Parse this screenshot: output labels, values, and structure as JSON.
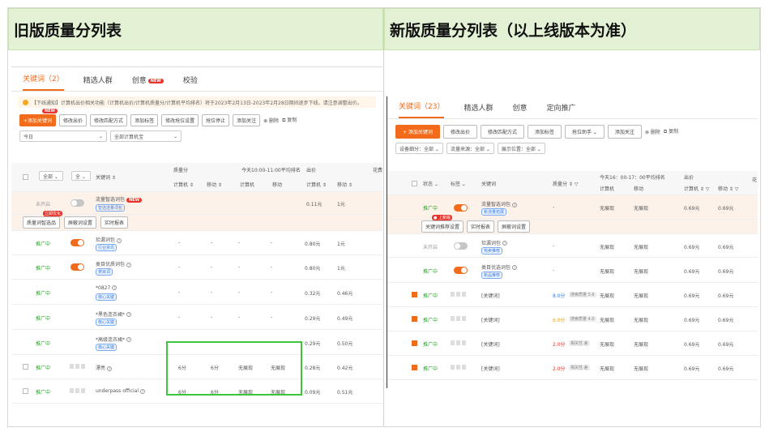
{
  "headers": {
    "left": "旧版质量分列表",
    "right": "新版质量分列表（以上线版本为准）"
  },
  "old": {
    "tabs": [
      {
        "label": "关键词（2）",
        "active": true
      },
      {
        "label": "精选人群"
      },
      {
        "label": "创意",
        "badge": "NEW"
      },
      {
        "label": "校验"
      }
    ],
    "notice": "【下线通知】计算机出价相关功能（计算机出价/计算机质量分/计算机平均排名）将于2023年2月13日-2023年2月28日期间逐步下线，请注意调整出价。",
    "toolbar": {
      "add": "+添加关键词",
      "add_badge": "NEW",
      "buttons": [
        "修改出价",
        "修改匹配方式",
        "添加标签",
        "修改抢位设置",
        "抢位停止",
        "添加关注"
      ],
      "delete": "删除",
      "copy": "复制"
    },
    "filters": {
      "date": "今日",
      "scope": "全部计算机宝"
    },
    "table_header": {
      "status_sel": "全部",
      "select2": "全",
      "keyword": "关键词",
      "qscore": "质量分",
      "rank_group": "今天10:00-11:00平均排名",
      "bid": "出价",
      "pc_qs": "计算机",
      "mobile_qs": "移动",
      "pc_rank": "计算机",
      "mobile_rank": "移动",
      "pc_bid": "计算机",
      "mobile_bid": "移动",
      "flow": "花费"
    },
    "pkg_row": {
      "status": "未开启",
      "name": "流量智选词包",
      "badge": "NEW",
      "tag": "智选选量词包",
      "bid_pc": "0.11元",
      "bid_mobile": "1元"
    },
    "pkg_actions": [
      "质量词智选品",
      "屏蔽词设置",
      "实时报表"
    ],
    "pkg_action_badge": "立即优化",
    "rows": [
      {
        "status": "推广中",
        "name": "捡漏词包",
        "tag": "行业资讯",
        "qs_pc": "-",
        "qs_mb": "-",
        "rk_pc": "-",
        "rk_mb": "-",
        "bid_pc": "0.80元",
        "bid_mb": "1元"
      },
      {
        "status": "推广中",
        "name": "类目优质词包",
        "tag": "类目词",
        "qs_pc": "-",
        "qs_mb": "-",
        "rk_pc": "-",
        "rk_mb": "-",
        "bid_pc": "0.80元",
        "bid_mb": "1元"
      },
      {
        "status": "推广中",
        "name": "*0827",
        "tag": "核心关键",
        "qs_pc": "-",
        "qs_mb": "-",
        "rk_pc": "-",
        "rk_mb": "-",
        "bid_pc": "0.32元",
        "bid_mb": "0.46元"
      },
      {
        "status": "推广中",
        "name": "*黑色连衣裙*",
        "tag": "核心关键",
        "qs_pc": "-",
        "qs_mb": "-",
        "rk_pc": "-",
        "rk_mb": "-",
        "bid_pc": "0.29元",
        "bid_mb": "0.49元"
      },
      {
        "status": "推广中",
        "name": "*高级连衣裙*",
        "tag": "核心关键",
        "qs_pc": "-",
        "qs_mb": "-",
        "rk_pc": "-",
        "rk_mb": "-",
        "bid_pc": "0.29元",
        "bid_mb": "0.50元"
      },
      {
        "status": "推广中",
        "name": "漂亮",
        "qs_pc": "6分",
        "qs_mb": "6分",
        "rk_pc": "无展现",
        "rk_mb": "无展现",
        "bid_pc": "0.28元",
        "bid_mb": "0.42元"
      },
      {
        "status": "推广中",
        "name": "underpass official",
        "qs_pc": "6分",
        "qs_mb": "6分",
        "rk_pc": "无展现",
        "rk_mb": "无展现",
        "bid_pc": "0.09元",
        "bid_mb": "0.51元"
      }
    ]
  },
  "new": {
    "tabs": [
      {
        "label": "关键词（23）",
        "active": true
      },
      {
        "label": "精选人群"
      },
      {
        "label": "创意"
      },
      {
        "label": "定向推广"
      }
    ],
    "toolbar": {
      "add": "+ 添加关键词",
      "buttons": [
        "修改出价",
        "修改匹配方式",
        "添加标签",
        "抢位助手",
        "添加关注"
      ],
      "delete": "删除",
      "copy": "复制"
    },
    "filters": {
      "f1": "设备细分：全部",
      "f2": "流量来源：全部",
      "f3": "展示位置：全部"
    },
    "table_header": {
      "status": "状态",
      "tag": "标签",
      "keyword": "关键词",
      "qscore": "质量分",
      "rank_group": "今天16：00-17：00平均排名",
      "bid": "出价",
      "pc_rank": "计算机",
      "mobile_rank": "移动",
      "pc_bid": "计算机",
      "mobile_bid": "移动",
      "extra": "花"
    },
    "pkg_row": {
      "status": "推广中",
      "name": "流量智选词包",
      "tag": "新流量拓展",
      "qs": "-",
      "rk_pc": "无展现",
      "rk_mb": "无展现",
      "bid_pc": "0.69元",
      "bid_mb": "0.69元"
    },
    "pkg_actions": [
      "关键词推荐设置",
      "实时报表",
      "屏蔽词设置"
    ],
    "pkg_action_badge": "上新版",
    "rows": [
      {
        "status": "未开启",
        "name": "捡漏词包",
        "tag": "热卖推荐",
        "qs": "-",
        "rk_pc": "无展现",
        "rk_mb": "无展现",
        "bid_pc": "0.69元",
        "bid_mb": "0.69元",
        "off": true
      },
      {
        "status": "推广中",
        "name": "类目优选词包",
        "tag": "新品推荐",
        "qs": "-",
        "rk_pc": "无展现",
        "rk_mb": "无展现",
        "bid_pc": "0.69元",
        "bid_mb": "0.69元"
      },
      {
        "status": "推广中",
        "name": "[关键词]",
        "qs": "8.0分",
        "qtag": "搜索质量 5.6",
        "rk_pc": "无展现",
        "rk_mb": "无展现",
        "bid_pc": "0.69元",
        "bid_mb": "0.69元"
      },
      {
        "status": "推广中",
        "name": "[关键词]",
        "qs": "6.0分",
        "qtag": "搜索质量 4.0",
        "rk_pc": "无展现",
        "rk_mb": "无展现",
        "bid_pc": "0.69元",
        "bid_mb": "0.69元"
      },
      {
        "status": "推广中",
        "name": "[关键词]",
        "qs": "2.0分",
        "qtag": "相关性 差",
        "rk_pc": "无展现",
        "rk_mb": "无展现",
        "bid_pc": "0.69元",
        "bid_mb": "0.69元"
      },
      {
        "status": "推广中",
        "name": "[关键词]",
        "qs": "2.0分",
        "qtag": "相关性 差",
        "rk_pc": "无展现",
        "rk_mb": "无展现",
        "bid_pc": "0.69元",
        "bid_mb": "0.69元"
      }
    ]
  },
  "colors": {
    "accent": "#f26b1a",
    "green": "#2aa32a",
    "highlight_box": "#3bc63b",
    "header_bg": "#e3f2d5"
  }
}
